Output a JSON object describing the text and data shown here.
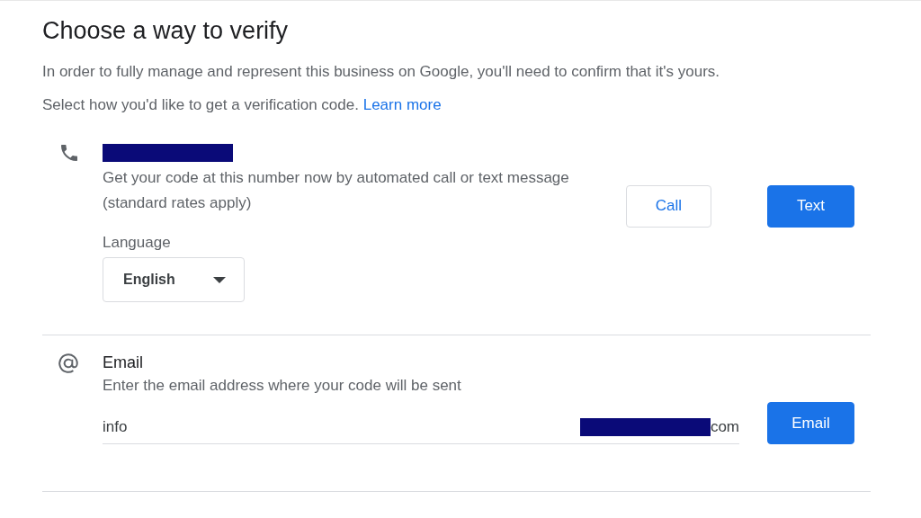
{
  "title": "Choose a way to verify",
  "intro": "In order to fully manage and represent this business on Google, you'll need to confirm that it's yours.",
  "prompt": {
    "text": "Select how you'd like to get a verification code.",
    "link": "Learn more"
  },
  "methods": [
    {
      "kind": "phone",
      "description": "Get your code at this number now by automated call or text message (standard rates apply)",
      "language_label": "Language",
      "language_value": "English",
      "buttons": [
        {
          "label": "Call",
          "primary": false
        },
        {
          "label": "Text",
          "primary": true
        }
      ]
    },
    {
      "kind": "email",
      "title": "Email",
      "description": "Enter the email address where your code will be sent",
      "value_prefix": "info",
      "value_suffix": "com",
      "buttons": [
        {
          "label": "Email",
          "primary": true
        }
      ]
    }
  ]
}
